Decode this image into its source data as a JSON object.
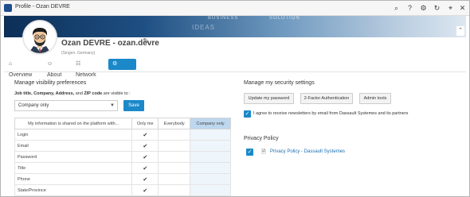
{
  "window": {
    "title": "Profile - Ozan DEVRE",
    "controls": [
      "search-icon",
      "help-icon",
      "settings-icon",
      "expand-icon",
      "pin-icon",
      "close-icon"
    ]
  },
  "banner": {
    "words": [
      "BUSINESS",
      "SOLUTION",
      "IDEAS"
    ]
  },
  "profile": {
    "name": "Ozan DEVRE - ozan.devre",
    "location": "(Singen, Germany)"
  },
  "nav": {
    "tabs": [
      {
        "label": "Overview",
        "icon": "home-icon"
      },
      {
        "label": "About",
        "icon": "user-icon"
      },
      {
        "label": "Network",
        "icon": "network-icon"
      },
      {
        "label": "Account",
        "icon": "gear-icon",
        "active": true
      }
    ]
  },
  "visibility": {
    "title": "Manage visibility preferences",
    "label_bold": "Job title, Company, Address,",
    "label_mid": " and ",
    "label_bold2": "ZIP code",
    "label_end": " are visible to :",
    "select_value": "Company only",
    "save_label": "Save",
    "table": {
      "headers": [
        "My information is shared on the platform with...",
        "Only me",
        "Everybody",
        "Company only"
      ],
      "rows": [
        {
          "label": "Login",
          "only_me": "✔"
        },
        {
          "label": "Email",
          "only_me": "✔"
        },
        {
          "label": "Password",
          "only_me": "✔"
        },
        {
          "label": "Title",
          "only_me": "✔"
        },
        {
          "label": "Phone",
          "only_me": "✔"
        },
        {
          "label": "State/Province",
          "only_me": "✔"
        }
      ]
    }
  },
  "security": {
    "title": "Manage my security settings",
    "buttons": [
      "Update my password",
      "2-Factor Authentication",
      "Admin tools"
    ],
    "newsletter_label": "I agree to receive newsletters by email from Dassault Systemes and its partners",
    "newsletter_checked": true
  },
  "privacy": {
    "title": "Privacy Policy",
    "link_label": "Privacy Policy - Dassault Systemes",
    "checked": true
  },
  "colors": {
    "accent": "#1a88c9",
    "selected_column": "#bdd7ee"
  }
}
